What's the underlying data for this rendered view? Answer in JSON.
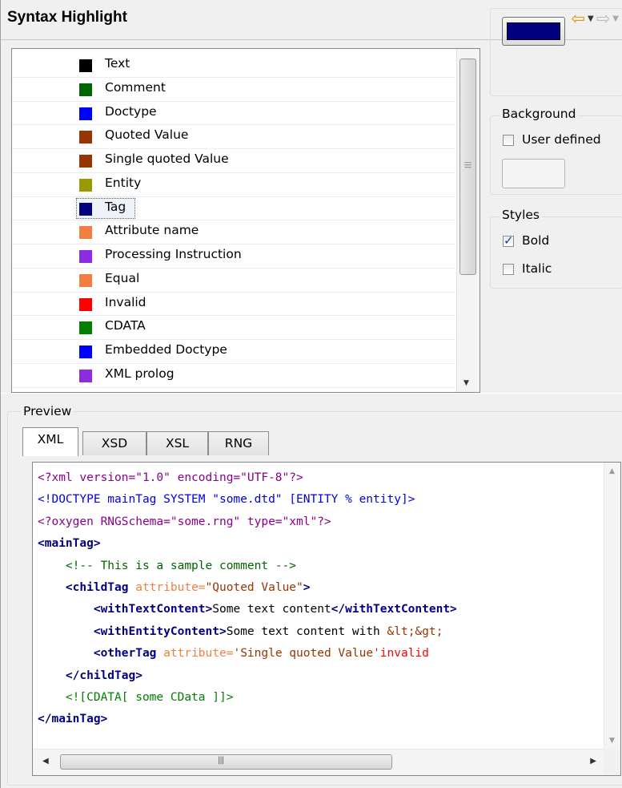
{
  "header": {
    "title": "Syntax Highlight"
  },
  "colors": {
    "selected_color": "#000080",
    "background_color_well": "#f4f4f4"
  },
  "list_items": [
    {
      "label": "Text",
      "color": "#000000"
    },
    {
      "label": "Comment",
      "color": "#006400"
    },
    {
      "label": "Doctype",
      "color": "#0000ff"
    },
    {
      "label": "Quoted Value",
      "color": "#993300"
    },
    {
      "label": "Single quoted Value",
      "color": "#993300"
    },
    {
      "label": "Entity",
      "color": "#999900"
    },
    {
      "label": "Tag",
      "color": "#000080",
      "selected": true
    },
    {
      "label": "Attribute name",
      "color": "#f08040"
    },
    {
      "label": "Processing Instruction",
      "color": "#8b2be2"
    },
    {
      "label": "Equal",
      "color": "#f08040"
    },
    {
      "label": "Invalid",
      "color": "#ff0000"
    },
    {
      "label": "CDATA",
      "color": "#008000"
    },
    {
      "label": "Embedded Doctype",
      "color": "#0000ff"
    },
    {
      "label": "XML prolog",
      "color": "#8b2be2"
    }
  ],
  "background": {
    "legend": "Background",
    "user_defined_label": "User defined",
    "user_defined_checked": false
  },
  "styles": {
    "legend": "Styles",
    "bold_label": "Bold",
    "bold_checked": true,
    "italic_label": "Italic",
    "italic_checked": false
  },
  "preview": {
    "legend": "Preview",
    "tabs": [
      "XML",
      "XSD",
      "XSL",
      "RNG"
    ],
    "active_tab": "XML",
    "code_lines": [
      [
        {
          "t": "<?xml version=\"1.0\" encoding=\"UTF-8\"?>",
          "c": "pi"
        }
      ],
      [
        {
          "t": "<!DOCTYPE mainTag SYSTEM \"some.dtd\" [ENTITY % entity]>",
          "c": "doctype"
        }
      ],
      [
        {
          "t": "<?oxygen RNGSchema=\"some.rng\" type=\"xml\"?>",
          "c": "pi"
        }
      ],
      [
        {
          "t": "<mainTag>",
          "c": "tag"
        }
      ],
      [
        {
          "t": "    ",
          "c": "text"
        },
        {
          "t": "<!-- This is a sample comment -->",
          "c": "comment"
        }
      ],
      [
        {
          "t": "    ",
          "c": "text"
        },
        {
          "t": "<childTag ",
          "c": "tag"
        },
        {
          "t": "attribute=",
          "c": "attr"
        },
        {
          "t": "\"Quoted Value\"",
          "c": "quoted"
        },
        {
          "t": ">",
          "c": "tag"
        }
      ],
      [
        {
          "t": "        ",
          "c": "text"
        },
        {
          "t": "<withTextContent>",
          "c": "tag"
        },
        {
          "t": "Some text content",
          "c": "text"
        },
        {
          "t": "</withTextContent>",
          "c": "tag"
        }
      ],
      [
        {
          "t": "        ",
          "c": "text"
        },
        {
          "t": "<withEntityContent>",
          "c": "tag"
        },
        {
          "t": "Some text content with ",
          "c": "text"
        },
        {
          "t": "&lt;&gt;",
          "c": "quoted"
        }
      ],
      [
        {
          "t": "        ",
          "c": "text"
        },
        {
          "t": "<otherTag ",
          "c": "tag"
        },
        {
          "t": "attribute=",
          "c": "attr"
        },
        {
          "t": "'Single quoted Value'",
          "c": "quoted"
        },
        {
          "t": "invalid",
          "c": "invalid"
        }
      ],
      [
        {
          "t": "    ",
          "c": "text"
        },
        {
          "t": "</childTag>",
          "c": "tag"
        }
      ],
      [
        {
          "t": "    ",
          "c": "text"
        },
        {
          "t": "<![CDATA[ some CData ]]>",
          "c": "cdata"
        }
      ],
      [
        {
          "t": "</mainTag>",
          "c": "tag"
        }
      ]
    ]
  }
}
